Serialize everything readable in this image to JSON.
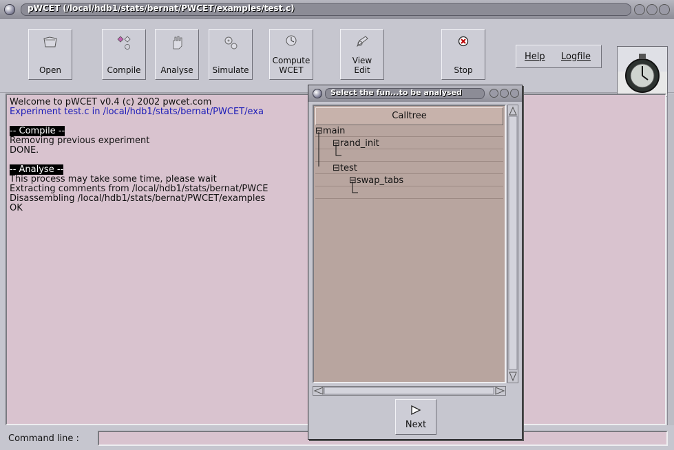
{
  "window": {
    "title": "pWCET (/local/hdb1/stats/bernat/PWCET/examples/test.c)"
  },
  "toolbar": {
    "open": "Open",
    "compile": "Compile",
    "analyse": "Analyse",
    "simulate": "Simulate",
    "compute_wcet": "Compute\nWCET",
    "view_edit": "View\nEdit",
    "stop": "Stop",
    "help": "Help",
    "logfile": "Logfile"
  },
  "output": {
    "lines": [
      {
        "text": "Welcome to pWCET v0.4 (c) 2002 pwcet.com",
        "style": "normal"
      },
      {
        "text": "Experiment test.c in /local/hdb1/stats/bernat/PWCET/exa",
        "style": "blue"
      },
      {
        "text": "",
        "style": "normal"
      },
      {
        "text": "-- Compile --",
        "style": "header"
      },
      {
        "text": "Removing previous experiment",
        "style": "normal"
      },
      {
        "text": "DONE.",
        "style": "normal"
      },
      {
        "text": "",
        "style": "normal"
      },
      {
        "text": "-- Analyse --",
        "style": "header"
      },
      {
        "text": "This process may take some time, please wait",
        "style": "normal"
      },
      {
        "text": "Extracting comments from /local/hdb1/stats/bernat/PWCE",
        "style": "normal"
      },
      {
        "text": "Disassembling /local/hdb1/stats/bernat/PWCET/examples",
        "style": "normal"
      },
      {
        "text": "OK",
        "style": "normal"
      }
    ]
  },
  "command_line": {
    "label": "Command line :",
    "value": ""
  },
  "dialog": {
    "title": "Select the fun...to be analysed",
    "column_header": "Calltree",
    "tree": {
      "main": "main",
      "rand_init": "rand_init",
      "test": "test",
      "swap_tabs": "swap_tabs"
    },
    "next": "Next"
  }
}
